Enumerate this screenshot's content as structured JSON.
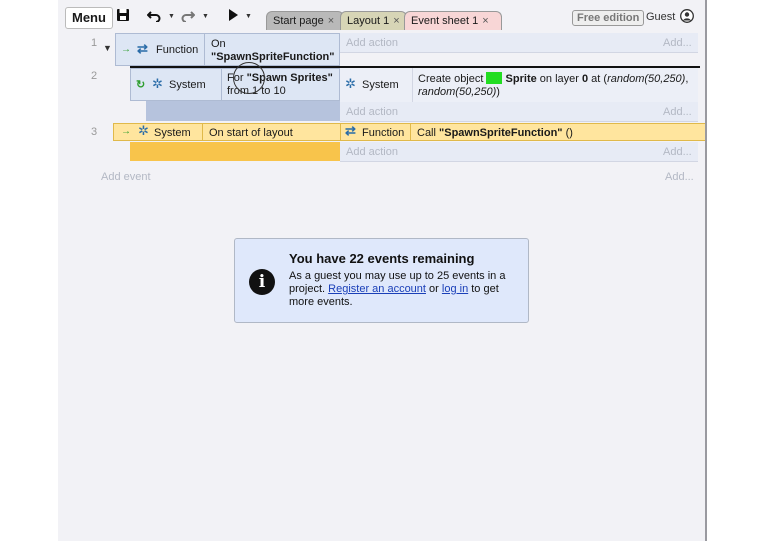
{
  "toolbar": {
    "menu_label": "Menu",
    "tabs": [
      {
        "label": "Start page"
      },
      {
        "label": "Layout 1"
      },
      {
        "label": "Event sheet 1"
      }
    ],
    "close_glyph": "×",
    "free_badge": "Free edition",
    "guest_label": "Guest"
  },
  "events": [
    {
      "number": "1",
      "condition": {
        "object": "Function",
        "text_prefix": "On",
        "text_name": "\"SpawnSpriteFunction\""
      },
      "add_action": "Add action",
      "add_right": "Add..."
    },
    {
      "number": "2",
      "condition": {
        "object": "System",
        "text_prefix": "For ",
        "text_name": "\"Spawn Sprites\"",
        "text_range": "from 1 to 10"
      },
      "action": {
        "object": "System",
        "part1": "Create object ",
        "obj_name": "Sprite",
        "part2": " on layer ",
        "layer": "0",
        "part3": " at (",
        "arg1": "random(50,250)",
        "part4": ",",
        "arg2": "random(50,250)",
        "part5": ")"
      },
      "add_action": "Add action",
      "add_right": "Add..."
    },
    {
      "number": "3",
      "condition": {
        "object": "System",
        "text": "On start of layout"
      },
      "action": {
        "object": "Function",
        "prefix": "Call ",
        "name": "\"SpawnSpriteFunction\"",
        "suffix": " ()"
      },
      "add_action": "Add action",
      "add_right": "Add..."
    }
  ],
  "add_event": "Add event",
  "add_event_right": "Add...",
  "dialog": {
    "title": "You have 22 events remaining",
    "line1": "As a guest you may use up to 25 events in a project.",
    "link1": "Register an account",
    "mid": " or ",
    "link2": "log in",
    "line2": " to get more events."
  },
  "colors": {
    "accent_blue": "#2a6ca8",
    "sprite_green": "#22dd22",
    "event_yellow": "#ffe59e",
    "condition_blue": "#dde6f4"
  }
}
